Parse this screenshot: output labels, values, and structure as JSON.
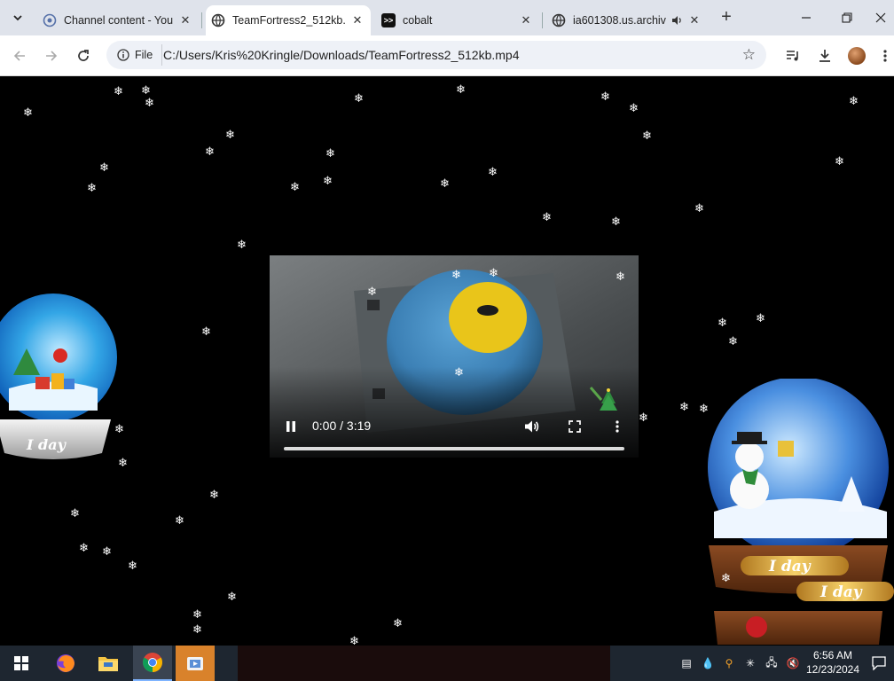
{
  "browser": {
    "tabs": [
      {
        "title": "Channel content - You",
        "favicon": "globe-icon",
        "active": false
      },
      {
        "title": "TeamFortress2_512kb.",
        "favicon": "globe-icon",
        "active": true
      },
      {
        "title": "cobalt",
        "favicon": "cobalt-icon",
        "active": false
      },
      {
        "title": "ia601308.us.archiv",
        "favicon": "globe-icon",
        "active": false,
        "audio": true
      }
    ],
    "address_chip": "File",
    "url": "C:/Users/Kris%20Kringle/Downloads/TeamFortress2_512kb.mp4"
  },
  "video": {
    "time": "0:00 / 3:19",
    "progress": 0
  },
  "overlays": {
    "globe_left_badge": "I day",
    "globe_right_badge": "I day",
    "globe_right_badge_2": "I day"
  },
  "taskbar": {
    "clock_time": "6:56 AM",
    "clock_date": "12/23/2024"
  },
  "colors": {
    "tabstrip": "#dfe3eb",
    "taskbar": "#1e2630",
    "page_background": "#000000"
  }
}
